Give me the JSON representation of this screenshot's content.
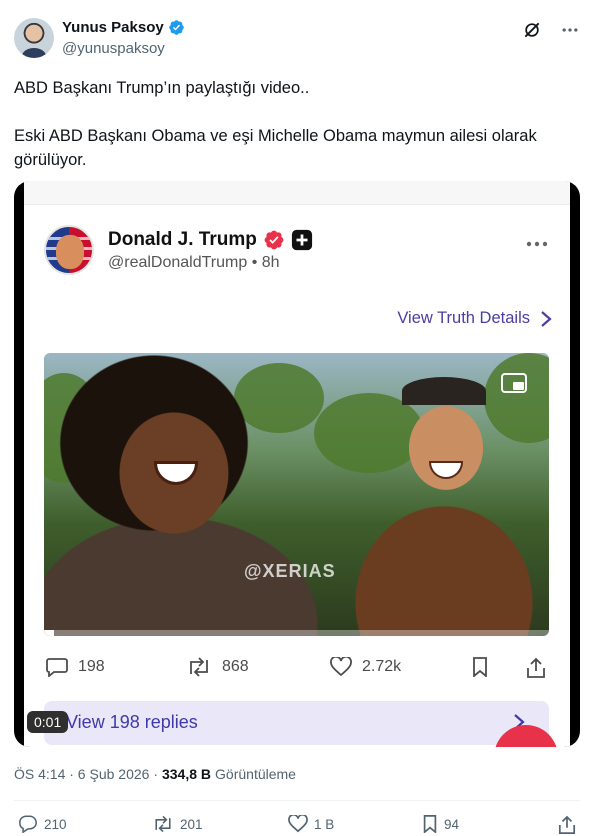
{
  "author": {
    "name": "Yunus Paksoy",
    "handle": "@yunuspaksoy"
  },
  "tweet": {
    "line1": "ABD Başkanı Trump’ın paylaştığı video..",
    "line2": "Eski ABD Başkanı Obama ve eşi Michelle Obama maymun ailesi olarak",
    "line3": "görülüyor."
  },
  "embedded_post": {
    "name": "Donald J. Trump",
    "handle_time": "@realDonaldTrump • 8h",
    "view_details_label": "View Truth Details",
    "video_watermark": "@XERIAS",
    "video_progress": 0.02,
    "replies_count": "198",
    "retruths_count": "868",
    "likes_count": "2.72k",
    "view_replies_label": "View 198 replies",
    "timecode": "0:01"
  },
  "meta": {
    "time_date": "ÖS 4:14 · 6 Şub 2026 ·",
    "views_number": "334,8 B",
    "views_label": "Görüntüleme"
  },
  "actions": {
    "replies": "210",
    "reposts": "201",
    "likes": "1 B",
    "bookmarks": "94"
  },
  "colors": {
    "verified_blue": "#1d9bf0",
    "truth_purple": "#4a3fa0",
    "text_secondary": "#536471"
  }
}
